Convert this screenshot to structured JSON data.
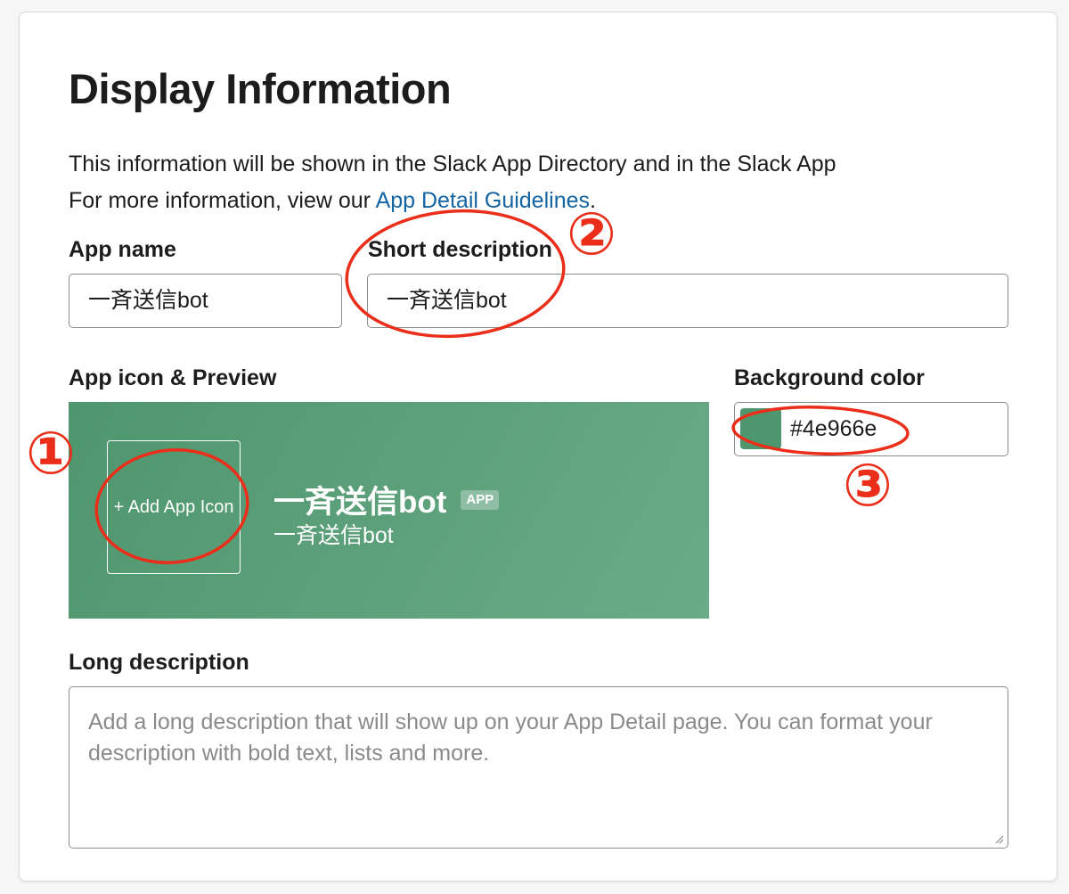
{
  "section": {
    "title": "Display Information",
    "intro_line1": "This information will be shown in the Slack App Directory and in the Slack App",
    "intro_line2_prefix": "For more information, view our ",
    "intro_link": "App Detail Guidelines",
    "intro_line2_suffix": "."
  },
  "app_name": {
    "label": "App name",
    "value": "一斉送信bot"
  },
  "short_description": {
    "label": "Short description",
    "value": "一斉送信bot"
  },
  "preview": {
    "label": "App icon & Preview",
    "add_icon_label": "+ Add App Icon",
    "app_name": "一斉送信bot",
    "badge": "APP",
    "description": "一斉送信bot"
  },
  "background_color": {
    "label": "Background color",
    "value": "#4e966e",
    "swatch": "#4e966e"
  },
  "long_description": {
    "label": "Long description",
    "placeholder": "Add a long description that will show up on your App Detail page. You can format your description with bold text, lists and more."
  },
  "annotations": {
    "marker_1": "①",
    "marker_2": "②",
    "marker_3": "③",
    "color": "#ea2e1a"
  }
}
